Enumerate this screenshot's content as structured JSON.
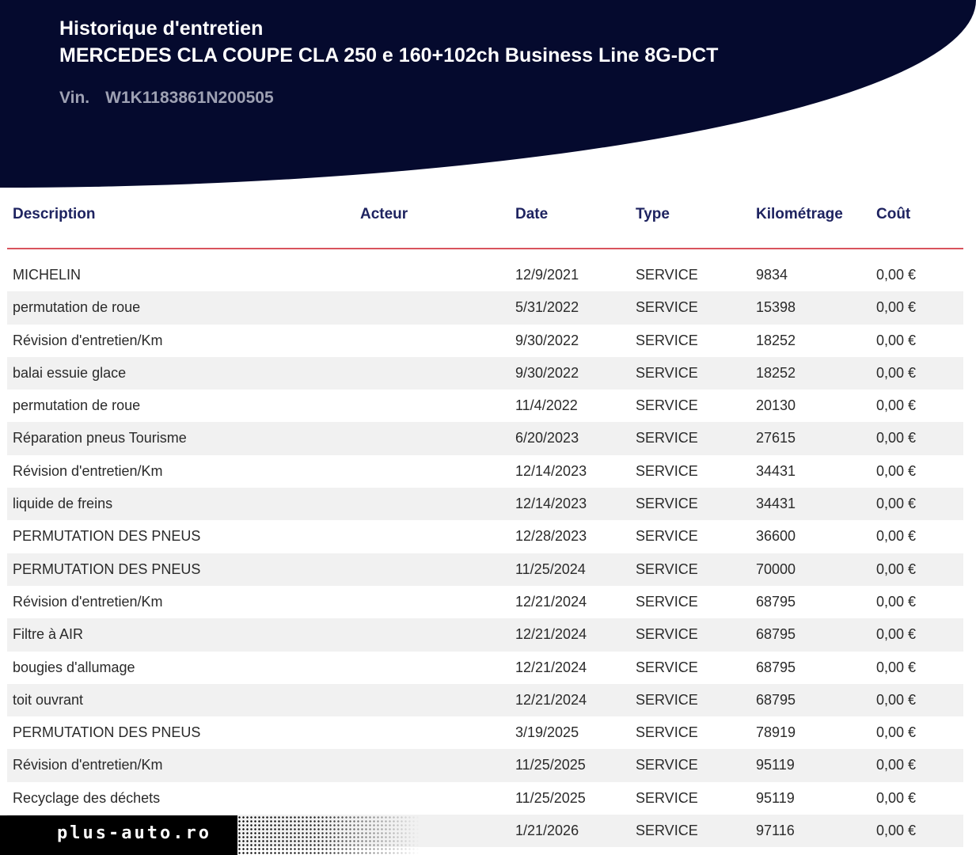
{
  "header": {
    "title": "Historique d'entretien",
    "vehicle": "MERCEDES CLA COUPE CLA 250 e 160+102ch Business Line 8G-DCT",
    "vin_label": "Vin.",
    "vin_value": "W1K1183861N200505"
  },
  "table": {
    "columns": [
      "Description",
      "Acteur",
      "Date",
      "Type",
      "Kilométrage",
      "Coût"
    ],
    "rows": [
      {
        "description": "MICHELIN",
        "acteur": "",
        "date": "12/9/2021",
        "type": "SERVICE",
        "km": "9834",
        "cost": "0,00 €"
      },
      {
        "description": "permutation de roue",
        "acteur": "",
        "date": "5/31/2022",
        "type": "SERVICE",
        "km": "15398",
        "cost": "0,00 €"
      },
      {
        "description": "Révision d'entretien/Km",
        "acteur": "",
        "date": "9/30/2022",
        "type": "SERVICE",
        "km": "18252",
        "cost": "0,00 €"
      },
      {
        "description": "balai essuie glace",
        "acteur": "",
        "date": "9/30/2022",
        "type": "SERVICE",
        "km": "18252",
        "cost": "0,00 €"
      },
      {
        "description": "permutation de roue",
        "acteur": "",
        "date": "11/4/2022",
        "type": "SERVICE",
        "km": "20130",
        "cost": "0,00 €"
      },
      {
        "description": "Réparation pneus Tourisme",
        "acteur": "",
        "date": "6/20/2023",
        "type": "SERVICE",
        "km": "27615",
        "cost": "0,00 €"
      },
      {
        "description": "Révision d'entretien/Km",
        "acteur": "",
        "date": "12/14/2023",
        "type": "SERVICE",
        "km": "34431",
        "cost": "0,00 €"
      },
      {
        "description": "liquide de freins",
        "acteur": "",
        "date": "12/14/2023",
        "type": "SERVICE",
        "km": "34431",
        "cost": "0,00 €"
      },
      {
        "description": "PERMUTATION DES PNEUS",
        "acteur": "",
        "date": "12/28/2023",
        "type": "SERVICE",
        "km": "36600",
        "cost": "0,00 €"
      },
      {
        "description": "PERMUTATION DES PNEUS",
        "acteur": "",
        "date": "11/25/2024",
        "type": "SERVICE",
        "km": "70000",
        "cost": "0,00 €"
      },
      {
        "description": "Révision d'entretien/Km",
        "acteur": "",
        "date": "12/21/2024",
        "type": "SERVICE",
        "km": "68795",
        "cost": "0,00 €"
      },
      {
        "description": "Filtre à  AIR",
        "acteur": "",
        "date": "12/21/2024",
        "type": "SERVICE",
        "km": "68795",
        "cost": "0,00 €"
      },
      {
        "description": "bougies d'allumage",
        "acteur": "",
        "date": "12/21/2024",
        "type": "SERVICE",
        "km": "68795",
        "cost": "0,00 €"
      },
      {
        "description": "toit ouvrant",
        "acteur": "",
        "date": "12/21/2024",
        "type": "SERVICE",
        "km": "68795",
        "cost": "0,00 €"
      },
      {
        "description": "PERMUTATION DES PNEUS",
        "acteur": "",
        "date": "3/19/2025",
        "type": "SERVICE",
        "km": "78919",
        "cost": "0,00 €"
      },
      {
        "description": "Révision d'entretien/Km",
        "acteur": "",
        "date": "11/25/2025",
        "type": "SERVICE",
        "km": "95119",
        "cost": "0,00 €"
      },
      {
        "description": "Recyclage des déchets",
        "acteur": "",
        "date": "11/25/2025",
        "type": "SERVICE",
        "km": "95119",
        "cost": "0,00 €"
      },
      {
        "description": "",
        "acteur": "",
        "date": "1/21/2026",
        "type": "SERVICE",
        "km": "97116",
        "cost": "0,00 €"
      }
    ]
  },
  "watermark": {
    "text": "plus-auto.ro"
  },
  "colors": {
    "header_bg": "#050a2e",
    "header_text": "#ffffff",
    "vin_text": "#9ea1b3",
    "column_header": "#1e2360",
    "divider": "#d9535d",
    "row_alt": "#f1f1f1"
  }
}
